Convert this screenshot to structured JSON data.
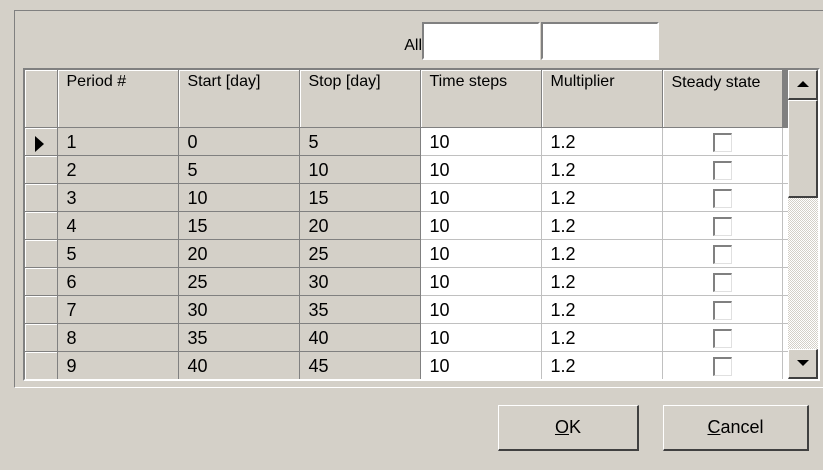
{
  "all_row": {
    "label": "All",
    "value_1": "",
    "value_2": ""
  },
  "table": {
    "columns": [
      "Period #",
      "Start [day]",
      "Stop [day]",
      "Time steps",
      "Multiplier",
      "Steady state"
    ],
    "selected_row_index": 0,
    "rows": [
      {
        "period": "1",
        "start": "0",
        "stop": "5",
        "steps": "10",
        "multiplier": "1.2",
        "steady": false
      },
      {
        "period": "2",
        "start": "5",
        "stop": "10",
        "steps": "10",
        "multiplier": "1.2",
        "steady": false
      },
      {
        "period": "3",
        "start": "10",
        "stop": "15",
        "steps": "10",
        "multiplier": "1.2",
        "steady": false
      },
      {
        "period": "4",
        "start": "15",
        "stop": "20",
        "steps": "10",
        "multiplier": "1.2",
        "steady": false
      },
      {
        "period": "5",
        "start": "20",
        "stop": "25",
        "steps": "10",
        "multiplier": "1.2",
        "steady": false
      },
      {
        "period": "6",
        "start": "25",
        "stop": "30",
        "steps": "10",
        "multiplier": "1.2",
        "steady": false
      },
      {
        "period": "7",
        "start": "30",
        "stop": "35",
        "steps": "10",
        "multiplier": "1.2",
        "steady": false
      },
      {
        "period": "8",
        "start": "35",
        "stop": "40",
        "steps": "10",
        "multiplier": "1.2",
        "steady": false
      },
      {
        "period": "9",
        "start": "40",
        "stop": "45",
        "steps": "10",
        "multiplier": "1.2",
        "steady": false
      }
    ]
  },
  "buttons": {
    "ok": {
      "mnemonic": "O",
      "rest": "K"
    },
    "cancel": {
      "mnemonic": "C",
      "rest": "ancel"
    }
  },
  "colors": {
    "face": "#d4d0c8",
    "shadow": "#808080",
    "highlight": "#ffffff",
    "cell": "#ffffff"
  }
}
